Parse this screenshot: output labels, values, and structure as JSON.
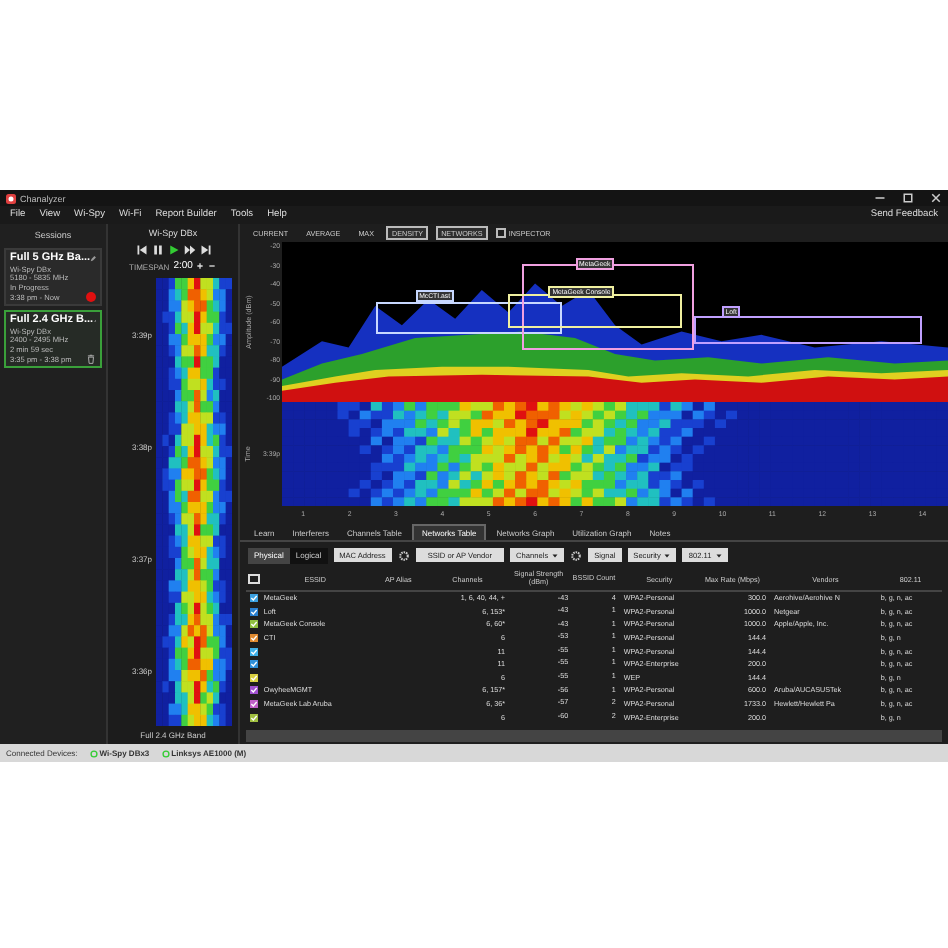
{
  "window": {
    "title": "Chanalyzer"
  },
  "menu": [
    "File",
    "View",
    "Wi-Spy",
    "Wi-Fi",
    "Report Builder",
    "Tools",
    "Help"
  ],
  "send_feedback": "Send Feedback",
  "sessions": {
    "title": "Sessions",
    "items": [
      {
        "name": "Full 5 GHz Ba...",
        "device": "Wi-Spy DBx",
        "range": "5180 - 5835 MHz",
        "duration": "In Progress",
        "time": "3:38 pm - Now",
        "selected": false,
        "recording": true
      },
      {
        "name": "Full 2.4 GHz B...",
        "device": "Wi-Spy DBx",
        "range": "2400 - 2495 MHz",
        "duration": "2 min 59 sec",
        "time": "3:35 pm - 3:38 pm",
        "selected": true,
        "recording": false
      }
    ]
  },
  "player": {
    "device": "Wi-Spy DBx",
    "timespan_label": "TIMESPAN",
    "timespan": "2:00",
    "time_labels": [
      "3:39p",
      "3:38p",
      "3:37p",
      "3:36p"
    ],
    "band": "Full 2.4 GHz Band"
  },
  "views": [
    {
      "label": "CURRENT",
      "kind": "toggle",
      "on": false
    },
    {
      "label": "AVERAGE",
      "kind": "toggle",
      "on": false
    },
    {
      "label": "MAX",
      "kind": "toggle",
      "on": false
    },
    {
      "label": "DENSITY",
      "kind": "toggle",
      "on": true
    },
    {
      "label": "NETWORKS",
      "kind": "toggle",
      "on": true
    },
    {
      "label": "INSPECTOR",
      "kind": "checkbox",
      "on": false
    }
  ],
  "density": {
    "ylabel": "Amplitude (dBm)",
    "yticks": [
      "-20",
      "-30",
      "-40",
      "-50",
      "-60",
      "-70",
      "-80",
      "-90",
      "-100"
    ],
    "networks": [
      {
        "label": "McCTI.ast",
        "color": "#c8d8ff"
      },
      {
        "label": "MetaGeek",
        "color": "#f0a0e0"
      },
      {
        "label": "MetaGeek Console",
        "color": "#f0f0a0"
      },
      {
        "label": "Loft",
        "color": "#c0a0ff"
      }
    ]
  },
  "waterfall": {
    "ylabel": "Time",
    "time_label": "3:39p",
    "xticks": [
      "1",
      "2",
      "3",
      "4",
      "5",
      "6",
      "7",
      "8",
      "9",
      "10",
      "11",
      "12",
      "13",
      "14"
    ]
  },
  "tabs": [
    {
      "label": "Learn",
      "selected": false
    },
    {
      "label": "Interferers",
      "selected": false
    },
    {
      "label": "Channels Table",
      "selected": false
    },
    {
      "label": "Networks Table",
      "selected": true
    },
    {
      "label": "Networks Graph",
      "selected": false
    },
    {
      "label": "Utilization Graph",
      "selected": false
    },
    {
      "label": "Notes",
      "selected": false
    }
  ],
  "filters": {
    "modes": [
      {
        "label": "Physical",
        "selected": true
      },
      {
        "label": "Logical",
        "selected": false
      }
    ],
    "mac": "MAC Address",
    "ssid": "SSID or AP Vendor",
    "channels": "Channels",
    "signal": "Signal",
    "security": "Security",
    "phy": "802.11"
  },
  "table": {
    "all_checked": false,
    "columns": [
      "ESSID",
      "AP Alias",
      "Channels",
      "Signal Strength (dBm)",
      "BSSID Count",
      "Security",
      "Max Rate (Mbps)",
      "Vendors",
      "802.11"
    ],
    "rows": [
      {
        "color": "#3aa0e0",
        "checked": true,
        "cells": [
          "MetaGeek",
          "",
          "1, 6, 40, 44, +",
          "-43",
          "4",
          "WPA2-Personal",
          "300.0",
          "Aerohive/Aerohive N",
          "b, g, n, ac"
        ]
      },
      {
        "color": "#2a80d0",
        "checked": true,
        "cells": [
          "Loft",
          "",
          "6, 153*",
          "-43",
          "1",
          "WPA2-Personal",
          "1000.0",
          "Netgear",
          "b, g, n, ac"
        ]
      },
      {
        "color": "#90c040",
        "checked": true,
        "cells": [
          "MetaGeek Console",
          "",
          "6, 60*",
          "-43",
          "1",
          "WPA2-Personal",
          "1000.0",
          "Apple/Apple, Inc.",
          "b, g, n, ac"
        ]
      },
      {
        "color": "#e08a30",
        "checked": true,
        "cells": [
          "CTI",
          "",
          "6",
          "-53",
          "1",
          "WPA2-Personal",
          "144.4",
          "",
          "b, g, n"
        ]
      },
      {
        "color": "#40b0e8",
        "checked": true,
        "cells": [
          "",
          "",
          "11",
          "-55",
          "1",
          "WPA2-Personal",
          "144.4",
          "",
          "b, g, n, ac"
        ]
      },
      {
        "color": "#3090d8",
        "checked": true,
        "cells": [
          "",
          "",
          "11",
          "-55",
          "1",
          "WPA2-Enterprise",
          "200.0",
          "",
          "b, g, n, ac"
        ]
      },
      {
        "color": "#d8d040",
        "checked": true,
        "cells": [
          "",
          "",
          "6",
          "-55",
          "1",
          "WEP",
          "144.4",
          "",
          "b, g, n"
        ]
      },
      {
        "color": "#a050d0",
        "checked": true,
        "cells": [
          "OwyheeMGMT",
          "",
          "6, 157*",
          "-56",
          "1",
          "WPA2-Personal",
          "600.0",
          "Aruba/AUCASUSTek",
          "b, g, n, ac"
        ]
      },
      {
        "color": "#c060c8",
        "checked": true,
        "cells": [
          "MetaGeek Lab Aruba",
          "",
          "6, 36*",
          "-57",
          "2",
          "WPA2-Personal",
          "1733.0",
          "Hewlett/Hewlett Pa",
          "b, g, n, ac"
        ]
      },
      {
        "color": "#a0c040",
        "checked": true,
        "cells": [
          "",
          "",
          "6",
          "-60",
          "2",
          "WPA2-Enterprise",
          "200.0",
          "",
          "b, g, n"
        ]
      }
    ]
  },
  "status": {
    "label": "Connected Devices:",
    "devices": [
      "Wi-Spy DBx3",
      "Linksys AE1000 (M)"
    ]
  }
}
